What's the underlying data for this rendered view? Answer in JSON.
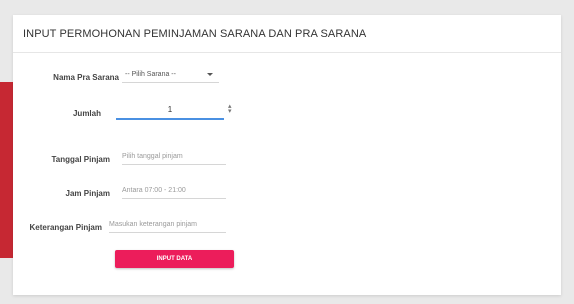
{
  "form": {
    "title": "INPUT PERMOHONAN PEMINJAMAN SARANA DAN PRA SARANA",
    "sarana": {
      "label": "Nama Pra Sarana",
      "value": "-- Pilih Sarana --"
    },
    "jumlah": {
      "label": "Jumlah",
      "value": "1"
    },
    "tanggal": {
      "label": "Tanggal Pinjam",
      "placeholder": "Pilih tanggal pinjam"
    },
    "jam": {
      "label": "Jam Pinjam",
      "placeholder": "Antara 07:00 - 21:00"
    },
    "keterangan": {
      "label": "Keterangan Pinjam",
      "placeholder": "Masukan keterangan pinjam"
    },
    "submit_label": "INPUT DATA"
  },
  "colors": {
    "accent": "#ec1d5b",
    "focus": "#4a90e2",
    "side": "#c62833"
  }
}
